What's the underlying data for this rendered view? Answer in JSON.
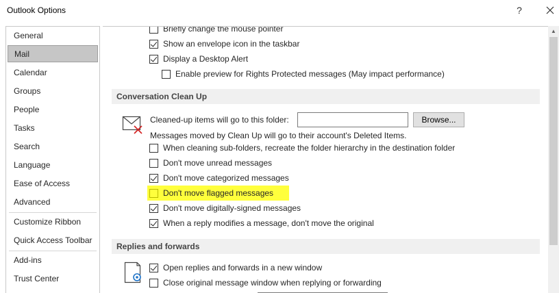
{
  "window": {
    "title": "Outlook Options",
    "help_label": "?",
    "close_label": "Close"
  },
  "sidebar": {
    "items": [
      {
        "label": "General",
        "active": false
      },
      {
        "label": "Mail",
        "active": true
      },
      {
        "label": "Calendar",
        "active": false
      },
      {
        "label": "Groups",
        "active": false
      },
      {
        "label": "People",
        "active": false
      },
      {
        "label": "Tasks",
        "active": false
      },
      {
        "label": "Search",
        "active": false
      },
      {
        "label": "Language",
        "active": false
      },
      {
        "label": "Ease of Access",
        "active": false
      },
      {
        "label": "Advanced",
        "active": false
      },
      {
        "label": "Customize Ribbon",
        "active": false
      },
      {
        "label": "Quick Access Toolbar",
        "active": false
      },
      {
        "label": "Add-ins",
        "active": false
      },
      {
        "label": "Trust Center",
        "active": false
      }
    ]
  },
  "message_arrival": {
    "options": [
      {
        "label": "Briefly change the mouse pointer",
        "checked": false
      },
      {
        "label": "Show an envelope icon in the taskbar",
        "checked": true
      },
      {
        "label": "Display a Desktop Alert",
        "checked": true
      },
      {
        "label": "Enable preview for Rights Protected messages (May impact performance)",
        "checked": false
      }
    ]
  },
  "conversation_cleanup": {
    "header": "Conversation Clean Up",
    "folder_label": "Cleaned-up items will go to this folder:",
    "folder_value": "",
    "browse_label": "Browse...",
    "moved_note": "Messages moved by Clean Up will go to their account's Deleted Items.",
    "options": [
      {
        "label": "When cleaning sub-folders, recreate the folder hierarchy in the destination folder",
        "checked": false
      },
      {
        "label": "Don't move unread messages",
        "checked": false
      },
      {
        "label": "Don't move categorized messages",
        "checked": true
      },
      {
        "label": "Don't move flagged messages",
        "checked": false,
        "highlighted": true
      },
      {
        "label": "Don't move digitally-signed messages",
        "checked": true
      },
      {
        "label": "When a reply modifies a message, don't move the original",
        "checked": true
      }
    ],
    "icon": "mail-cleanup-icon"
  },
  "replies_forwards": {
    "header": "Replies and forwards",
    "options": [
      {
        "label": "Open replies and forwards in a new window",
        "checked": true
      },
      {
        "label": "Close original message window when replying or forwarding",
        "checked": false
      }
    ],
    "icon": "reply-settings-icon"
  },
  "colors": {
    "highlight": "#ffff3c",
    "nav_active_bg": "#c6c6c6",
    "section_header_bg": "#f0f0f0"
  }
}
